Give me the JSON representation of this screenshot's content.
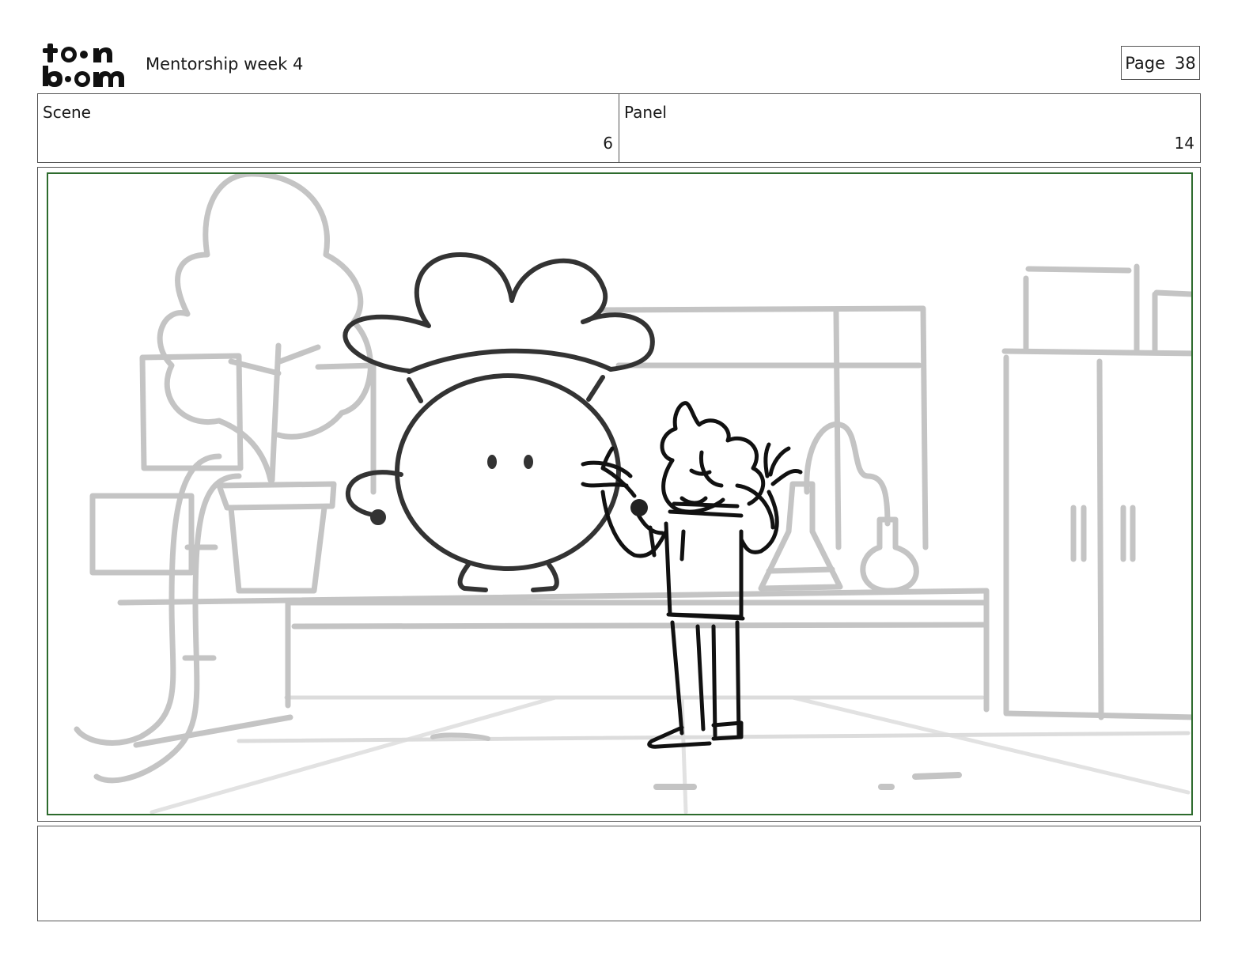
{
  "header": {
    "logo_text": "toon boom",
    "project_title": "Mentorship week 4",
    "page_label": "Page",
    "page_number": "38"
  },
  "scene": {
    "label": "Scene",
    "value": "6"
  },
  "panel": {
    "label": "Panel",
    "value": "14"
  },
  "notes": {
    "text": ""
  }
}
